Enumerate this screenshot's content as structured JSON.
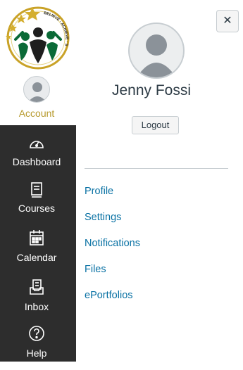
{
  "sidebar": {
    "account_label": "Account",
    "logo_arc_text": "BELIEVE · ACHIEVE · SUCCEED",
    "items": [
      {
        "label": "Dashboard",
        "icon": "dashboard-icon"
      },
      {
        "label": "Courses",
        "icon": "courses-icon"
      },
      {
        "label": "Calendar",
        "icon": "calendar-icon"
      },
      {
        "label": "Inbox",
        "icon": "inbox-icon"
      },
      {
        "label": "Help",
        "icon": "help-icon"
      }
    ]
  },
  "tray": {
    "user_name": "Jenny Fossi",
    "logout_label": "Logout",
    "close_symbol": "✕",
    "links": [
      {
        "label": "Profile"
      },
      {
        "label": "Settings"
      },
      {
        "label": "Notifications"
      },
      {
        "label": "Files"
      },
      {
        "label": "ePortfolios"
      }
    ]
  },
  "colors": {
    "nav_background": "#2d2d2d",
    "account_label": "#b79a2e",
    "link": "#0770a3",
    "text_dark": "#2d3b45"
  }
}
